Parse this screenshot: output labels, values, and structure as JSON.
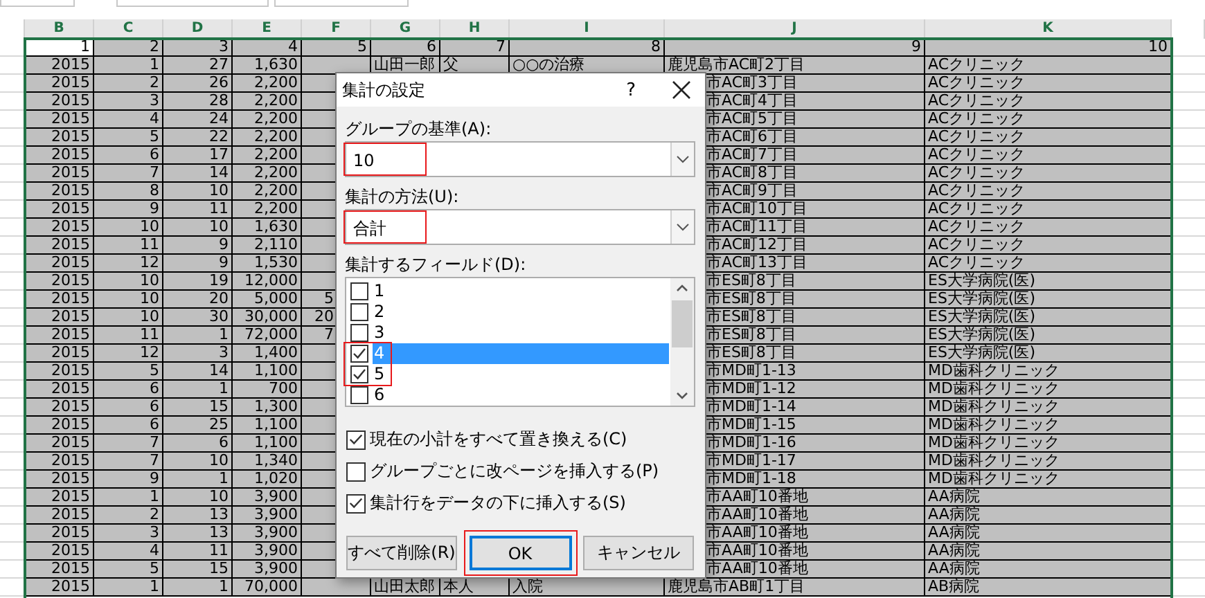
{
  "sheet": {
    "column_letters": [
      "B",
      "C",
      "D",
      "E",
      "F",
      "G",
      "H",
      "I",
      "J",
      "K"
    ],
    "header_row": [
      "1",
      "2",
      "3",
      "4",
      "5",
      "6",
      "7",
      "8",
      "9",
      "10"
    ],
    "rows": [
      [
        "2015",
        "1",
        "27",
        "1,630",
        null,
        "山田一郎",
        "父",
        "○○の治療",
        "鹿児島市AC町2丁目",
        "ACクリニック"
      ],
      [
        "2015",
        "2",
        "26",
        "2,200",
        null,
        null,
        null,
        null,
        "市AC町3丁目",
        "ACクリニック"
      ],
      [
        "2015",
        "3",
        "28",
        "2,200",
        null,
        null,
        null,
        null,
        "市AC町4丁目",
        "ACクリニック"
      ],
      [
        "2015",
        "4",
        "24",
        "2,200",
        null,
        null,
        null,
        null,
        "市AC町5丁目",
        "ACクリニック"
      ],
      [
        "2015",
        "5",
        "22",
        "2,200",
        null,
        null,
        null,
        null,
        "市AC町6丁目",
        "ACクリニック"
      ],
      [
        "2015",
        "6",
        "17",
        "2,200",
        null,
        null,
        null,
        null,
        "市AC町7丁目",
        "ACクリニック"
      ],
      [
        "2015",
        "7",
        "14",
        "2,200",
        null,
        null,
        null,
        null,
        "市AC町8丁目",
        "ACクリニック"
      ],
      [
        "2015",
        "8",
        "10",
        "2,200",
        null,
        null,
        null,
        null,
        "市AC町9丁目",
        "ACクリニック"
      ],
      [
        "2015",
        "9",
        "11",
        "2,200",
        null,
        null,
        null,
        null,
        "市AC町10丁目",
        "ACクリニック"
      ],
      [
        "2015",
        "10",
        "10",
        "1,630",
        null,
        null,
        null,
        null,
        "市AC町11丁目",
        "ACクリニック"
      ],
      [
        "2015",
        "11",
        "9",
        "2,110",
        null,
        null,
        null,
        null,
        "市AC町12丁目",
        "ACクリニック"
      ],
      [
        "2015",
        "12",
        "9",
        "1,530",
        null,
        null,
        null,
        null,
        "市AC町13丁目",
        "ACクリニック"
      ],
      [
        "2015",
        "10",
        "19",
        "12,000",
        null,
        null,
        null,
        null,
        "市ES町8丁目",
        "ES大学病院(医)"
      ],
      [
        "2015",
        "10",
        "20",
        "5,000",
        "5",
        null,
        null,
        null,
        "市ES町8丁目",
        "ES大学病院(医)"
      ],
      [
        "2015",
        "10",
        "30",
        "30,000",
        "20",
        null,
        null,
        null,
        "市ES町8丁目",
        "ES大学病院(医)"
      ],
      [
        "2015",
        "11",
        "1",
        "72,000",
        "7",
        null,
        null,
        null,
        "市ES町8丁目",
        "ES大学病院(医)"
      ],
      [
        "2015",
        "12",
        "3",
        "1,400",
        null,
        null,
        null,
        null,
        "市ES町8丁目",
        "ES大学病院(医)"
      ],
      [
        "2015",
        "5",
        "14",
        "1,100",
        null,
        null,
        null,
        null,
        "市MD町1-13",
        "MD歯科クリニック"
      ],
      [
        "2015",
        "6",
        "1",
        "700",
        null,
        null,
        null,
        null,
        "市MD町1-12",
        "MD歯科クリニック"
      ],
      [
        "2015",
        "6",
        "15",
        "1,300",
        null,
        null,
        null,
        null,
        "市MD町1-14",
        "MD歯科クリニック"
      ],
      [
        "2015",
        "6",
        "25",
        "1,100",
        null,
        null,
        null,
        null,
        "市MD町1-15",
        "MD歯科クリニック"
      ],
      [
        "2015",
        "7",
        "6",
        "1,100",
        null,
        null,
        null,
        null,
        "市MD町1-16",
        "MD歯科クリニック"
      ],
      [
        "2015",
        "7",
        "10",
        "1,340",
        null,
        null,
        null,
        null,
        "市MD町1-17",
        "MD歯科クリニック"
      ],
      [
        "2015",
        "9",
        "1",
        "1,020",
        null,
        null,
        null,
        null,
        "市MD町1-18",
        "MD歯科クリニック"
      ],
      [
        "2015",
        "1",
        "10",
        "3,900",
        null,
        null,
        null,
        null,
        "市AA町10番地",
        "AA病院"
      ],
      [
        "2015",
        "2",
        "13",
        "3,900",
        null,
        null,
        null,
        null,
        "市AA町10番地",
        "AA病院"
      ],
      [
        "2015",
        "3",
        "13",
        "3,900",
        null,
        null,
        null,
        null,
        "市AA町10番地",
        "AA病院"
      ],
      [
        "2015",
        "4",
        "11",
        "3,900",
        null,
        null,
        null,
        null,
        "市AA町10番地",
        "AA病院"
      ],
      [
        "2015",
        "5",
        "15",
        "3,900",
        null,
        null,
        null,
        null,
        "市AA町10番地",
        "AA病院"
      ],
      [
        "2015",
        "1",
        "1",
        "70,000",
        null,
        "山田太郎",
        "本人",
        "入院",
        "鹿児島市AB町1丁目",
        "AB病院"
      ]
    ]
  },
  "dialog": {
    "title": "集計の設定",
    "help": "?",
    "group_by": {
      "label": "グループの基準(A):",
      "value": "10",
      "annotated": true
    },
    "function": {
      "label": "集計の方法(U):",
      "value": "合計",
      "annotated": true
    },
    "fields": {
      "label": "集計するフィールド(D):",
      "items": [
        {
          "label": "1",
          "checked": false,
          "selected": false,
          "annotated": false
        },
        {
          "label": "2",
          "checked": false,
          "selected": false,
          "annotated": false
        },
        {
          "label": "3",
          "checked": false,
          "selected": false,
          "annotated": false
        },
        {
          "label": "4",
          "checked": true,
          "selected": true,
          "annotated": true
        },
        {
          "label": "5",
          "checked": true,
          "selected": false,
          "annotated": true
        },
        {
          "label": "6",
          "checked": false,
          "selected": false,
          "annotated": false
        }
      ]
    },
    "options": [
      {
        "label": "現在の小計をすべて置き換える(C)",
        "checked": true
      },
      {
        "label": "グループごとに改ページを挿入する(P)",
        "checked": false
      },
      {
        "label": "集計行をデータの下に挿入する(S)",
        "checked": true
      }
    ],
    "buttons": [
      {
        "label": "すべて削除(R)",
        "default": false,
        "annotated": false
      },
      {
        "label": "OK",
        "default": true,
        "annotated": true
      },
      {
        "label": "キャンセル",
        "default": false,
        "annotated": false
      }
    ]
  }
}
